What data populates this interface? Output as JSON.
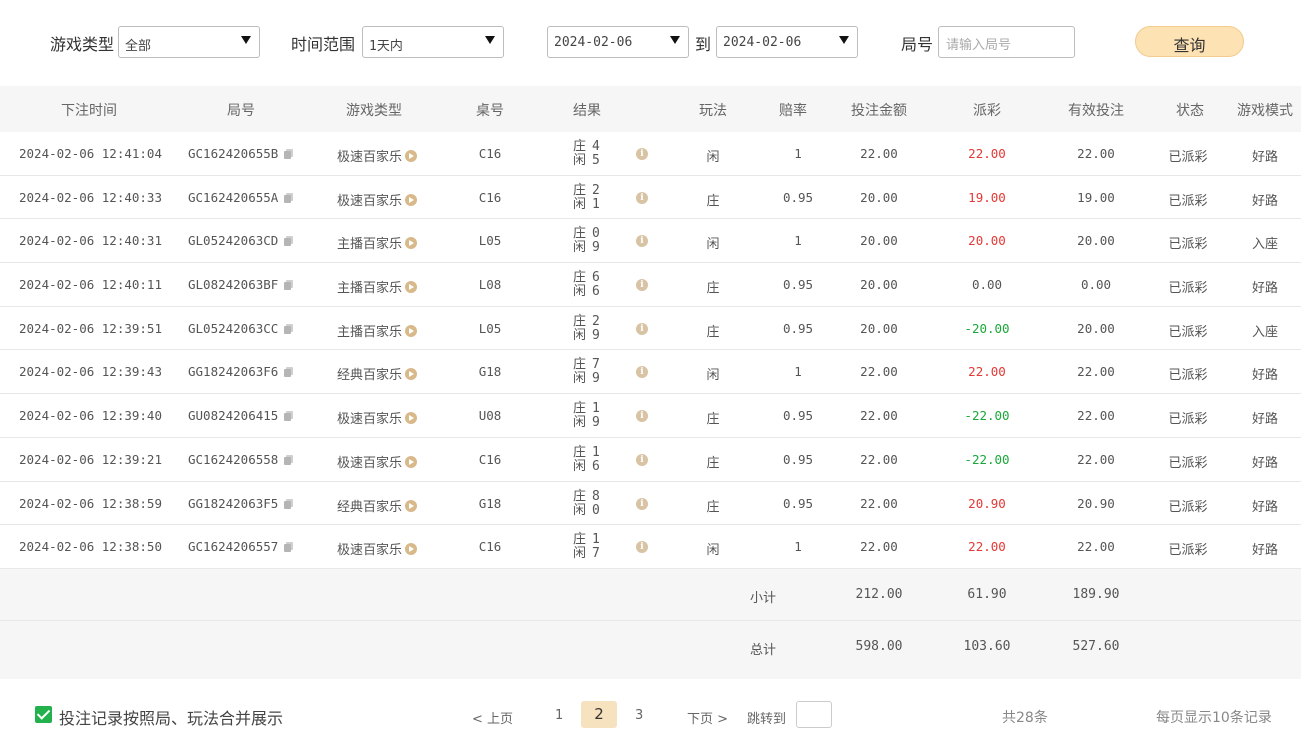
{
  "filters": {
    "game_type_label": "游戏类型",
    "game_type_value": "全部",
    "time_range_label": "时间范围",
    "time_range_value": "1天内",
    "date_from": "2024-02-06",
    "date_sep": "到",
    "date_to": "2024-02-06",
    "round_label": "局号",
    "round_placeholder": "请输入局号",
    "query_button": "查询"
  },
  "columns": [
    "下注时间",
    "局号",
    "游戏类型",
    "桌号",
    "结果",
    "玩法",
    "赔率",
    "投注金额",
    "派彩",
    "有效投注",
    "状态",
    "游戏模式"
  ],
  "result_labels": {
    "banker": "庄",
    "player": "闲"
  },
  "rows": [
    {
      "time": "2024-02-06 12:41:04",
      "round": "GC162420655B",
      "game": "极速百家乐",
      "table": "C16",
      "banker": "4",
      "player": "5",
      "bet_on": "闲",
      "odds": "1",
      "amount": "22.00",
      "payout": "22.00",
      "payout_color": "red",
      "valid": "22.00",
      "status": "已派彩",
      "mode": "好路"
    },
    {
      "time": "2024-02-06 12:40:33",
      "round": "GC162420655A",
      "game": "极速百家乐",
      "table": "C16",
      "banker": "2",
      "player": "1",
      "bet_on": "庄",
      "odds": "0.95",
      "amount": "20.00",
      "payout": "19.00",
      "payout_color": "red",
      "valid": "19.00",
      "status": "已派彩",
      "mode": "好路"
    },
    {
      "time": "2024-02-06 12:40:31",
      "round": "GL05242063CD",
      "game": "主播百家乐",
      "table": "L05",
      "banker": "0",
      "player": "9",
      "bet_on": "闲",
      "odds": "1",
      "amount": "20.00",
      "payout": "20.00",
      "payout_color": "red",
      "valid": "20.00",
      "status": "已派彩",
      "mode": "入座"
    },
    {
      "time": "2024-02-06 12:40:11",
      "round": "GL08242063BF",
      "game": "主播百家乐",
      "table": "L08",
      "banker": "6",
      "player": "6",
      "bet_on": "庄",
      "odds": "0.95",
      "amount": "20.00",
      "payout": "0.00",
      "payout_color": "gray",
      "valid": "0.00",
      "status": "已派彩",
      "mode": "好路"
    },
    {
      "time": "2024-02-06 12:39:51",
      "round": "GL05242063CC",
      "game": "主播百家乐",
      "table": "L05",
      "banker": "2",
      "player": "9",
      "bet_on": "庄",
      "odds": "0.95",
      "amount": "20.00",
      "payout": "-20.00",
      "payout_color": "green",
      "valid": "20.00",
      "status": "已派彩",
      "mode": "入座"
    },
    {
      "time": "2024-02-06 12:39:43",
      "round": "GG18242063F6",
      "game": "经典百家乐",
      "table": "G18",
      "banker": "7",
      "player": "9",
      "bet_on": "闲",
      "odds": "1",
      "amount": "22.00",
      "payout": "22.00",
      "payout_color": "red",
      "valid": "22.00",
      "status": "已派彩",
      "mode": "好路"
    },
    {
      "time": "2024-02-06 12:39:40",
      "round": "GU0824206415",
      "game": "极速百家乐",
      "table": "U08",
      "banker": "1",
      "player": "9",
      "bet_on": "庄",
      "odds": "0.95",
      "amount": "22.00",
      "payout": "-22.00",
      "payout_color": "green",
      "valid": "22.00",
      "status": "已派彩",
      "mode": "好路"
    },
    {
      "time": "2024-02-06 12:39:21",
      "round": "GC1624206558",
      "game": "极速百家乐",
      "table": "C16",
      "banker": "1",
      "player": "6",
      "bet_on": "庄",
      "odds": "0.95",
      "amount": "22.00",
      "payout": "-22.00",
      "payout_color": "green",
      "valid": "22.00",
      "status": "已派彩",
      "mode": "好路"
    },
    {
      "time": "2024-02-06 12:38:59",
      "round": "GG18242063F5",
      "game": "经典百家乐",
      "table": "G18",
      "banker": "8",
      "player": "0",
      "bet_on": "庄",
      "odds": "0.95",
      "amount": "22.00",
      "payout": "20.90",
      "payout_color": "red",
      "valid": "20.90",
      "status": "已派彩",
      "mode": "好路"
    },
    {
      "time": "2024-02-06 12:38:50",
      "round": "GC1624206557",
      "game": "极速百家乐",
      "table": "C16",
      "banker": "1",
      "player": "7",
      "bet_on": "闲",
      "odds": "1",
      "amount": "22.00",
      "payout": "22.00",
      "payout_color": "red",
      "valid": "22.00",
      "status": "已派彩",
      "mode": "好路"
    }
  ],
  "subtotal": {
    "label": "小计",
    "amount": "212.00",
    "payout": "61.90",
    "valid": "189.90"
  },
  "total": {
    "label": "总计",
    "amount": "598.00",
    "payout": "103.60",
    "valid": "527.60"
  },
  "footer": {
    "merge_checked": true,
    "merge_label": "投注记录按照局、玩法合并展示",
    "prev": "< 上页",
    "pages": [
      "1",
      "2",
      "3"
    ],
    "current_page": "2",
    "next": "下页 >",
    "jump_label": "跳转到",
    "total_count": "共28条",
    "per_page": "每页显示10条记录"
  },
  "colors": {
    "red": "#e53935",
    "green": "#1aa83a",
    "gray": "#555555",
    "accent": "#fde2b4",
    "check": "#23b14d"
  }
}
